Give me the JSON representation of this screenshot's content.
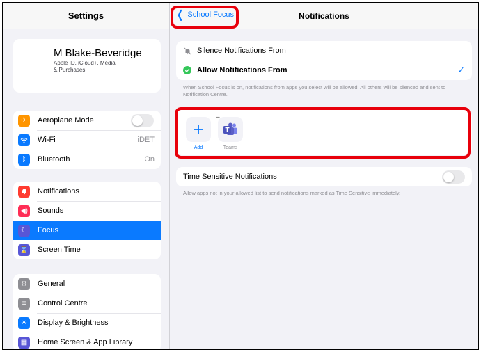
{
  "sidebar": {
    "title": "Settings",
    "profile": {
      "name": "M Blake-Beveridge",
      "subtitle_line1": "Apple ID, iCloud+, Media",
      "subtitle_line2": "& Purchases"
    },
    "groups": [
      {
        "items": [
          {
            "label": "Aeroplane Mode",
            "icon": "airplane-icon",
            "color": "#ff9500",
            "toggle": false
          },
          {
            "label": "Wi-Fi",
            "icon": "wifi-icon",
            "color": "#0a7aff",
            "value": "iDET"
          },
          {
            "label": "Bluetooth",
            "icon": "bluetooth-icon",
            "color": "#0a7aff",
            "value": "On"
          }
        ]
      },
      {
        "items": [
          {
            "label": "Notifications",
            "icon": "bell-icon",
            "color": "#ff3b30"
          },
          {
            "label": "Sounds",
            "icon": "speaker-icon",
            "color": "#ff2d55"
          },
          {
            "label": "Focus",
            "icon": "moon-icon",
            "color": "#5856d6",
            "selected": true
          },
          {
            "label": "Screen Time",
            "icon": "hourglass-icon",
            "color": "#5856d6"
          }
        ]
      },
      {
        "items": [
          {
            "label": "General",
            "icon": "gear-icon",
            "color": "#8e8e93"
          },
          {
            "label": "Control Centre",
            "icon": "sliders-icon",
            "color": "#8e8e93"
          },
          {
            "label": "Display & Brightness",
            "icon": "sun-icon",
            "color": "#0a7aff"
          },
          {
            "label": "Home Screen & App Library",
            "icon": "grid-icon",
            "color": "#5856d6"
          }
        ]
      }
    ]
  },
  "header": {
    "back_label": "School Focus",
    "title": "Notifications"
  },
  "silence_row": {
    "label": "Silence Notifications From",
    "icon": "bell-slash-icon"
  },
  "allow_row": {
    "label": "Allow Notifications From",
    "icon": "checkmark-circle-icon",
    "checked": true
  },
  "allow_note": "When School Focus is on, notifications from apps you select will be allowed. All others will be silenced and sent to Notification Centre.",
  "apps": [
    {
      "label": "Add",
      "icon": "plus-icon"
    },
    {
      "label": "Teams",
      "icon": "teams-icon"
    }
  ],
  "time_sensitive": {
    "label": "Time Sensitive Notifications",
    "enabled": false,
    "note": "Allow apps not in your allowed list to send notifications marked as Time Sensitive immediately."
  },
  "colors": {
    "accent": "#0a7aff",
    "highlight": "#e8000b",
    "teams": "#5b5fc7"
  }
}
